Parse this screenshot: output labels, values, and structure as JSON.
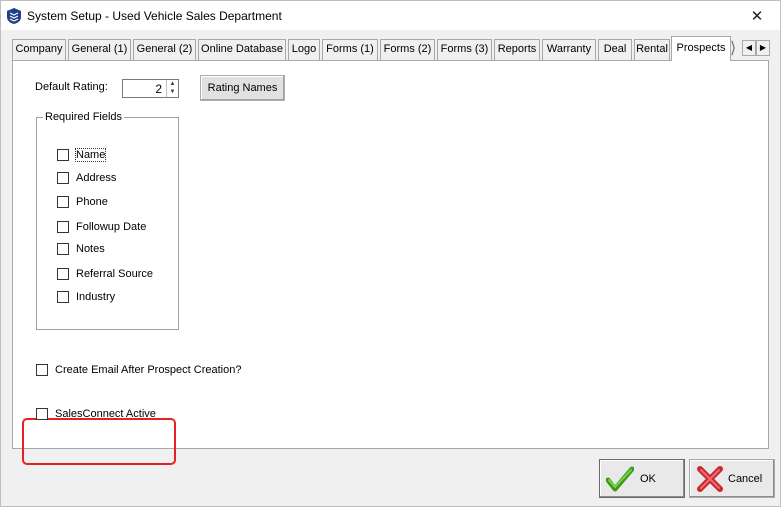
{
  "window": {
    "title": "System Setup - Used Vehicle Sales Department",
    "close_glyph": "✕"
  },
  "tabs": [
    {
      "label": "Company",
      "active": false
    },
    {
      "label": "General (1)",
      "active": false
    },
    {
      "label": "General (2)",
      "active": false
    },
    {
      "label": "Online Database",
      "active": false
    },
    {
      "label": "Logo",
      "active": false
    },
    {
      "label": "Forms (1)",
      "active": false
    },
    {
      "label": "Forms (2)",
      "active": false
    },
    {
      "label": "Forms (3)",
      "active": false
    },
    {
      "label": "Reports",
      "active": false
    },
    {
      "label": "Warranty",
      "active": false
    },
    {
      "label": "Deal",
      "active": false
    },
    {
      "label": "Rental",
      "active": false
    },
    {
      "label": "Prospects",
      "active": true
    }
  ],
  "tab_scroll": {
    "left_glyph": "◀",
    "right_glyph": "▶"
  },
  "prospects": {
    "default_rating_label": "Default Rating:",
    "default_rating_value": "2",
    "spin_up_glyph": "▲",
    "spin_down_glyph": "▼",
    "rating_names_button": "Rating Names",
    "required_fields_title": "Required Fields",
    "required_fields": [
      {
        "label": "Name",
        "checked": false
      },
      {
        "label": "Address",
        "checked": false
      },
      {
        "label": "Phone",
        "checked": false
      },
      {
        "label": "Followup Date",
        "checked": false
      },
      {
        "label": "Notes",
        "checked": false
      },
      {
        "label": "Referral Source",
        "checked": false
      },
      {
        "label": "Industry",
        "checked": false
      }
    ],
    "create_email_label": "Create Email After Prospect Creation?",
    "create_email_checked": false,
    "salesconnect_label": "SalesConnect Active",
    "salesconnect_checked": false
  },
  "footer": {
    "ok_label": "OK",
    "cancel_label": "Cancel"
  },
  "colors": {
    "highlight": "#e52222",
    "ok_check": "#4caf27",
    "cancel_x": "#d9343a"
  },
  "icons": {
    "title": "app-shield-icon",
    "close": "close-icon",
    "ok": "checkmark-icon",
    "cancel": "red-x-icon"
  }
}
